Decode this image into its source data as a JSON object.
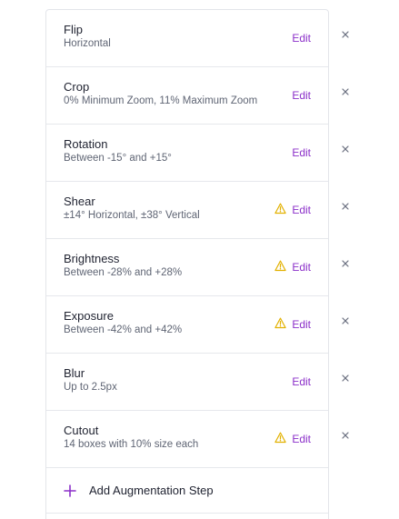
{
  "steps": [
    {
      "title": "Flip",
      "subtitle": "Horizontal",
      "edit_label": "Edit",
      "warning": false,
      "remove_icon": "close-icon"
    },
    {
      "title": "Crop",
      "subtitle": "0% Minimum Zoom, 11% Maximum Zoom",
      "edit_label": "Edit",
      "warning": false,
      "remove_icon": "close-icon"
    },
    {
      "title": "Rotation",
      "subtitle": "Between -15° and +15°",
      "edit_label": "Edit",
      "warning": false,
      "remove_icon": "close-icon"
    },
    {
      "title": "Shear",
      "subtitle": "±14° Horizontal, ±38° Vertical",
      "edit_label": "Edit",
      "warning": true,
      "remove_icon": "close-icon"
    },
    {
      "title": "Brightness",
      "subtitle": "Between -28% and +28%",
      "edit_label": "Edit",
      "warning": true,
      "remove_icon": "close-icon"
    },
    {
      "title": "Exposure",
      "subtitle": "Between -42% and +42%",
      "edit_label": "Edit",
      "warning": true,
      "remove_icon": "close-icon"
    },
    {
      "title": "Blur",
      "subtitle": "Up to 2.5px",
      "edit_label": "Edit",
      "warning": false,
      "remove_icon": "close-icon"
    },
    {
      "title": "Cutout",
      "subtitle": "14 boxes with 10% size each",
      "edit_label": "Edit",
      "warning": true,
      "remove_icon": "close-icon"
    }
  ],
  "add_step": {
    "label": "Add Augmentation Step",
    "icon": "plus-icon"
  },
  "colors": {
    "accent": "#8b2fc9",
    "warning": "#e2b100",
    "close": "#6b7080",
    "border": "#e6e8ec",
    "title_text": "#1f2230",
    "subtitle_text": "#5f6574"
  }
}
